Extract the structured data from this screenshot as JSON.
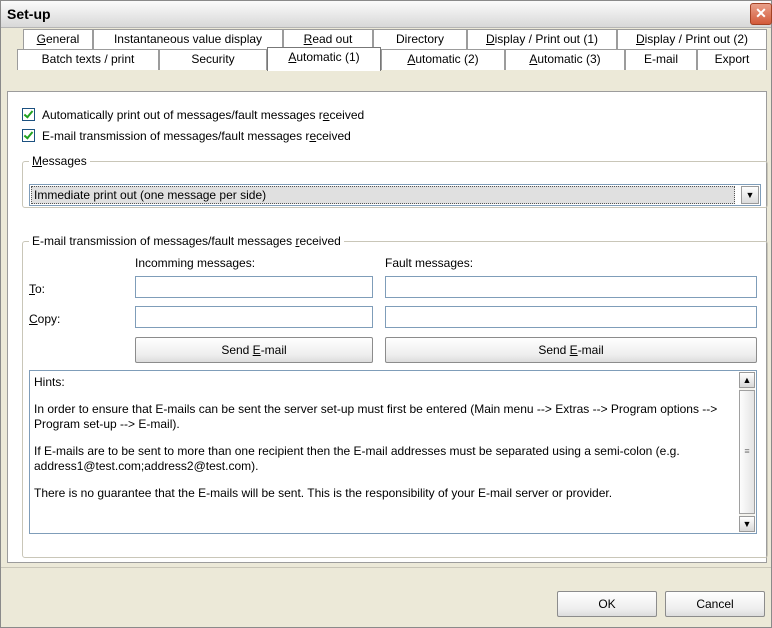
{
  "window": {
    "title": "Set-up",
    "close_glyph": "✕"
  },
  "tabs": {
    "row1": [
      {
        "pre": "",
        "u": "G",
        "post": "eneral"
      },
      {
        "pre": "Instantaneous value display",
        "u": "",
        "post": ""
      },
      {
        "pre": "",
        "u": "R",
        "post": "ead out"
      },
      {
        "pre": "Directory",
        "u": "",
        "post": ""
      },
      {
        "pre": "",
        "u": "D",
        "post": "isplay / Print out (1)"
      },
      {
        "pre": "",
        "u": "D",
        "post": "isplay / Print out (2)"
      }
    ],
    "row2": [
      {
        "pre": "Batch texts / print",
        "u": "",
        "post": ""
      },
      {
        "pre": "Security",
        "u": "",
        "post": ""
      },
      {
        "pre": "",
        "u": "A",
        "post": "utomatic (1)"
      },
      {
        "pre": "",
        "u": "A",
        "post": "utomatic (2)"
      },
      {
        "pre": "",
        "u": "A",
        "post": "utomatic (3)"
      },
      {
        "pre": "E-mail",
        "u": "",
        "post": ""
      },
      {
        "pre": "Export",
        "u": "",
        "post": ""
      }
    ],
    "active": "Automatic (1)"
  },
  "checkboxes": [
    {
      "pre": "Automatically print out of messages/fault messages r",
      "u": "e",
      "post": "ceived",
      "checked": true
    },
    {
      "pre": "E-mail transmission of messages/fault messages r",
      "u": "e",
      "post": "ceived",
      "checked": true
    }
  ],
  "messages_group": {
    "legend_u": "M",
    "legend_post": "essages",
    "selected": "Immediate print out (one message per side)"
  },
  "email_group": {
    "legend_pre": "E-mail transmission of messages/fault messages ",
    "legend_u": "r",
    "legend_post": "eceived",
    "col_incoming": "Incomming messages:",
    "col_fault": "Fault messages:",
    "to_u": "T",
    "to_post": "o:",
    "copy_u": "C",
    "copy_post": "opy:",
    "send_pre": "Send ",
    "send_u": "E",
    "send_post": "-mail",
    "to_incoming_value": "",
    "to_fault_value": "",
    "copy_incoming_value": "",
    "copy_fault_value": ""
  },
  "hints": {
    "title": "Hints:",
    "p1": "In order to ensure that E-mails can be sent the server set-up must first be entered (Main menu --> Extras --> Program options --> Program set-up --> E-mail).",
    "p2": "If E-mails are to be sent to more than one recipient then the E-mail addresses must be separated using a semi-colon (e.g. address1@test.com;address2@test.com).",
    "p3": "There is no guarantee that the E-mails will be sent. This is the responsibility of your E-mail server or provider."
  },
  "footer": {
    "ok": "OK",
    "cancel": "Cancel"
  },
  "icons": [
    "close-icon",
    "dropdown-arrow-icon",
    "scroll-up-icon",
    "scroll-down-icon",
    "checkbox-check-icon"
  ]
}
